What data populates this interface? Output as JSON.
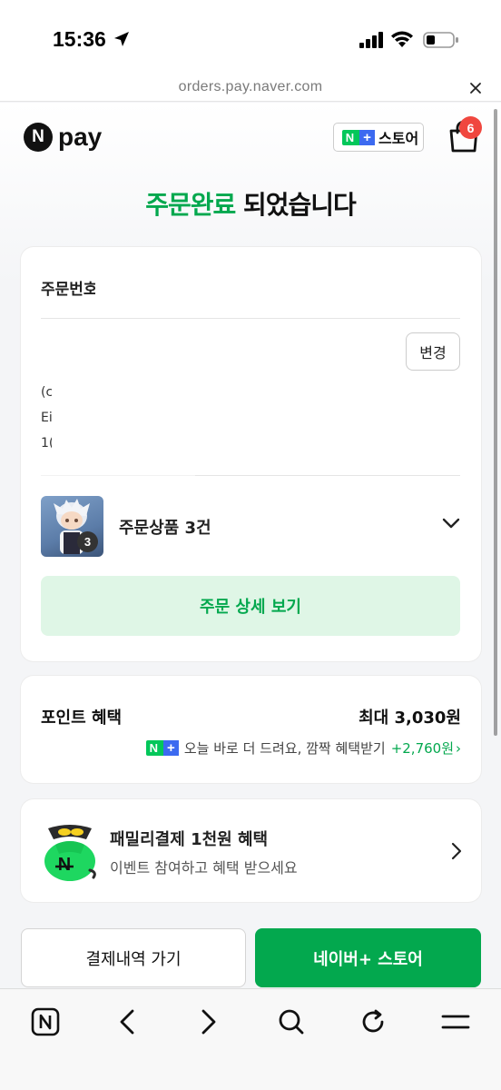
{
  "status_bar": {
    "time": "15:36"
  },
  "browser": {
    "url": "orders.pay.naver.com"
  },
  "header": {
    "logo_letter": "N",
    "logo_text": "pay",
    "store_chip_n": "N",
    "store_chip_plus": "+",
    "store_chip_label": "스토어",
    "cart_count": "6"
  },
  "headline": {
    "highlight": "주문완료",
    "rest": " 되었습니다"
  },
  "order_card": {
    "order_number_label": "주문번호",
    "change_button": "변경",
    "partial_lines": [
      "(c",
      "Ei",
      "1("
    ],
    "item_count_badge": "3",
    "items_label": "주문상품 3건",
    "detail_button": "주문 상세 보기"
  },
  "points_card": {
    "title": "포인트 혜택",
    "max_label": "최대 3,030원",
    "promo_text": "오늘 바로 더 드려요, 깜짝 혜택받기",
    "promo_amount": "+2,760원",
    "promo_arrow": "›"
  },
  "family_card": {
    "title": "패밀리결제 1천원 혜택",
    "subtitle": "이벤트 참여하고 혜택 받으세요"
  },
  "actions": {
    "history_button": "결제내역 가기",
    "store_button": "네이버+ 스토어"
  },
  "colors": {
    "brand_green": "#03a84e",
    "naver_green": "#03c75a",
    "plus_blue": "#3c6af0",
    "badge_red": "#f0473f"
  },
  "icons": [
    "location-arrow-icon",
    "signal-icon",
    "wifi-icon",
    "battery-icon",
    "close-icon",
    "cart-icon",
    "chevron-down-icon",
    "chevron-right-icon",
    "moneybag-icon",
    "naver-home-icon",
    "back-icon",
    "forward-icon",
    "search-icon",
    "refresh-icon",
    "menu-icon"
  ]
}
